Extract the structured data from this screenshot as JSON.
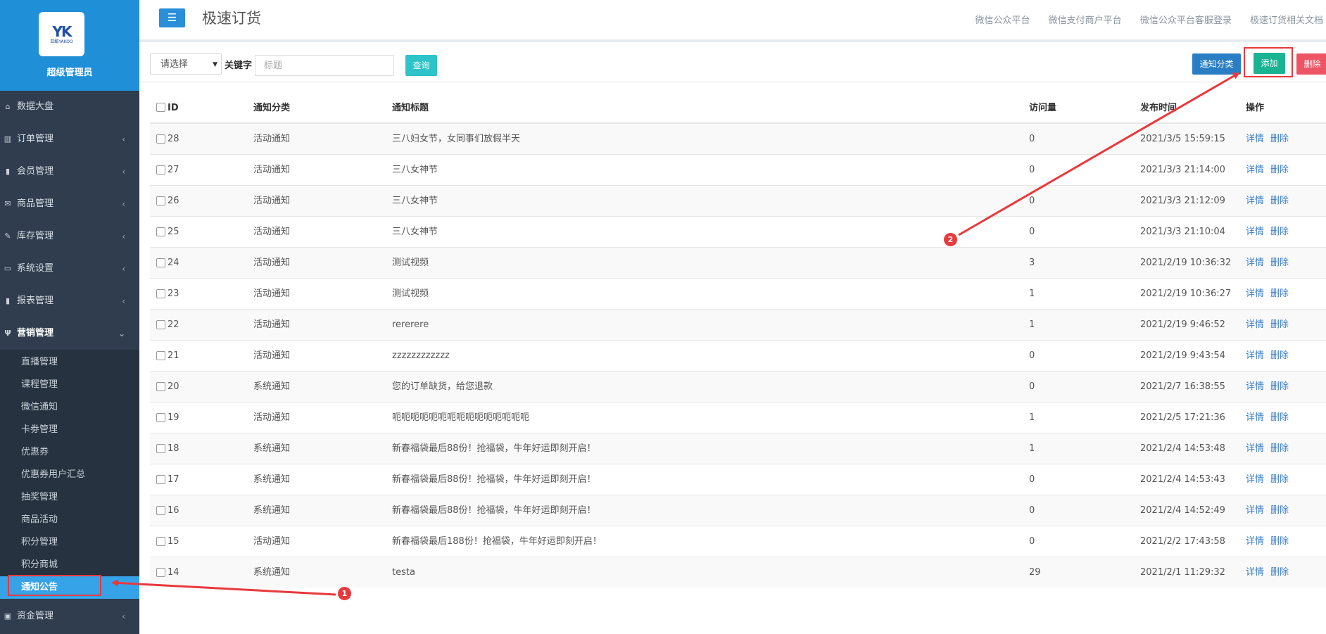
{
  "brand": {
    "logo_text": "YK",
    "logo_subtext": "亚酷YAKOO",
    "title": "超级管理员"
  },
  "sidebar": {
    "items": [
      {
        "label": "数据大盘",
        "icon": "home-icon"
      },
      {
        "label": "订单管理",
        "icon": "columns-icon"
      },
      {
        "label": "会员管理",
        "icon": "bar-chart-icon"
      },
      {
        "label": "商品管理",
        "icon": "envelope-icon"
      },
      {
        "label": "库存管理",
        "icon": "edit-icon"
      },
      {
        "label": "系统设置",
        "icon": "desktop-icon"
      },
      {
        "label": "报表管理",
        "icon": "bar-chart-icon"
      },
      {
        "label": "营销管理",
        "icon": "cutlery-icon"
      }
    ],
    "submenu": [
      "直播管理",
      "课程管理",
      "微信通知",
      "卡劵管理",
      "优惠券",
      "优惠券用户汇总",
      "抽奖管理",
      "商品活动",
      "积分管理",
      "积分商城",
      "通知公告"
    ],
    "last_item": {
      "label": "资金管理",
      "icon": "money-icon"
    }
  },
  "header": {
    "menu_icon": "☰",
    "title": "极速订货",
    "links": [
      "微信公众平台",
      "微信支付商户平台",
      "微信公众平台客服登录",
      "极速订货相关文档"
    ]
  },
  "toolbar": {
    "select_value": "请选择",
    "keyword_label": "关键字",
    "search_placeholder": "标题",
    "query_label": "查询",
    "category_label": "通知分类",
    "add_label": "添加",
    "delete_label": "删除"
  },
  "table": {
    "headers": [
      "ID",
      "通知分类",
      "通知标题",
      "访问量",
      "发布时间",
      "操作"
    ],
    "rows": [
      {
        "id": "28",
        "category": "活动通知",
        "title": "三八妇女节，女同事们放假半天",
        "visits": "0",
        "time": "2021/3/5 15:59:15"
      },
      {
        "id": "27",
        "category": "活动通知",
        "title": "三八女神节",
        "visits": "0",
        "time": "2021/3/3 21:14:00"
      },
      {
        "id": "26",
        "category": "活动通知",
        "title": "三八女神节",
        "visits": "0",
        "time": "2021/3/3 21:12:09"
      },
      {
        "id": "25",
        "category": "活动通知",
        "title": "三八女神节",
        "visits": "0",
        "time": "2021/3/3 21:10:04"
      },
      {
        "id": "24",
        "category": "活动通知",
        "title": "测试视频",
        "visits": "3",
        "time": "2021/2/19 10:36:32"
      },
      {
        "id": "23",
        "category": "活动通知",
        "title": "测试视频",
        "visits": "1",
        "time": "2021/2/19 10:36:27"
      },
      {
        "id": "22",
        "category": "活动通知",
        "title": "rererere",
        "visits": "1",
        "time": "2021/2/19 9:46:52"
      },
      {
        "id": "21",
        "category": "活动通知",
        "title": "zzzzzzzzzzzz",
        "visits": "0",
        "time": "2021/2/19 9:43:54"
      },
      {
        "id": "20",
        "category": "系统通知",
        "title": "您的订单缺货，给您退款",
        "visits": "0",
        "time": "2021/2/7 16:38:55"
      },
      {
        "id": "19",
        "category": "活动通知",
        "title": "呃呃呃呃呃呃呃呃呃呃呃呃呃呃呃",
        "visits": "1",
        "time": "2021/2/5 17:21:36"
      },
      {
        "id": "18",
        "category": "系统通知",
        "title": "新春福袋最后88份！抢福袋，牛年好运即刻开启！",
        "visits": "1",
        "time": "2021/2/4 14:53:48"
      },
      {
        "id": "17",
        "category": "系统通知",
        "title": "新春福袋最后88份！抢福袋，牛年好运即刻开启！",
        "visits": "0",
        "time": "2021/2/4 14:53:43"
      },
      {
        "id": "16",
        "category": "系统通知",
        "title": "新春福袋最后88份！抢福袋，牛年好运即刻开启！",
        "visits": "0",
        "time": "2021/2/4 14:52:49"
      },
      {
        "id": "15",
        "category": "活动通知",
        "title": "新春福袋最后188份！抢福袋，牛年好运即刻开启！",
        "visits": "0",
        "time": "2021/2/2 17:43:58"
      },
      {
        "id": "14",
        "category": "系统通知",
        "title": "testa",
        "visits": "29",
        "time": "2021/2/1 11:29:32"
      }
    ],
    "actions": [
      "详情",
      "删除"
    ]
  },
  "annotations": [
    "1",
    "2"
  ],
  "colors": {
    "sidebar_bg": "#2f3d4e",
    "brand_bg": "#1f8fd8",
    "active_sub": "#36a3e8",
    "query_btn": "#2dc3c8",
    "category_btn": "#2a7ec4",
    "add_btn": "#1ab394",
    "delete_btn": "#ed5565",
    "annotation": "#e8393d"
  }
}
